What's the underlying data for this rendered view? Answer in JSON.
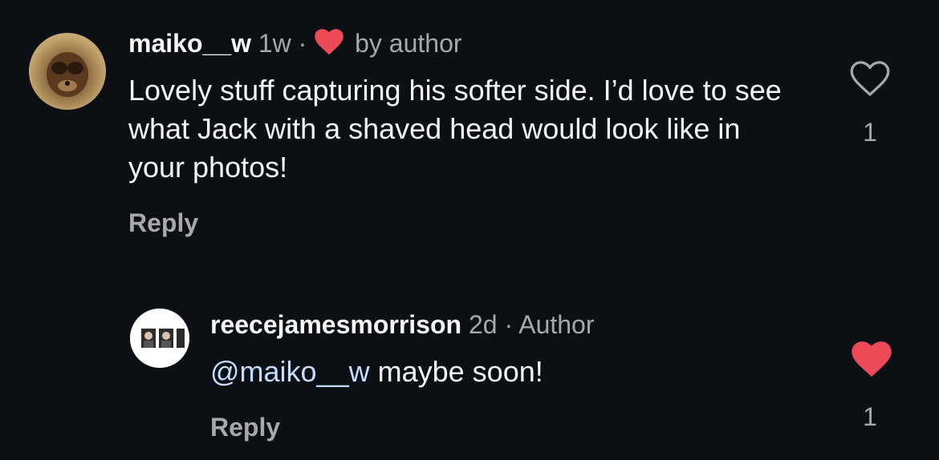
{
  "comments": [
    {
      "username": "maiko__w",
      "time": "1w",
      "separator": "·",
      "liked_by_author_label": "by author",
      "text": "Lovely stuff capturing his softer side. I’d love to see what Jack with a shaved head would look like in your photos!",
      "reply_label": "Reply",
      "like_count": "1",
      "liked": false,
      "avatar_icon": "avatar-photo-icon"
    },
    {
      "username": "reecejamesmorrison",
      "time": "2d",
      "separator": "·",
      "author_badge": "Author",
      "mention": "@maiko__w",
      "text": " maybe soon!",
      "reply_label": "Reply",
      "like_count": "1",
      "liked": true,
      "avatar_icon": "avatar-photo-icon"
    }
  ],
  "colors": {
    "background": "#0c1014",
    "primary_text": "#f5f5f5",
    "secondary_text": "#a8a8a8",
    "mention": "#c4ddff",
    "heart_red": "#ed4956"
  }
}
